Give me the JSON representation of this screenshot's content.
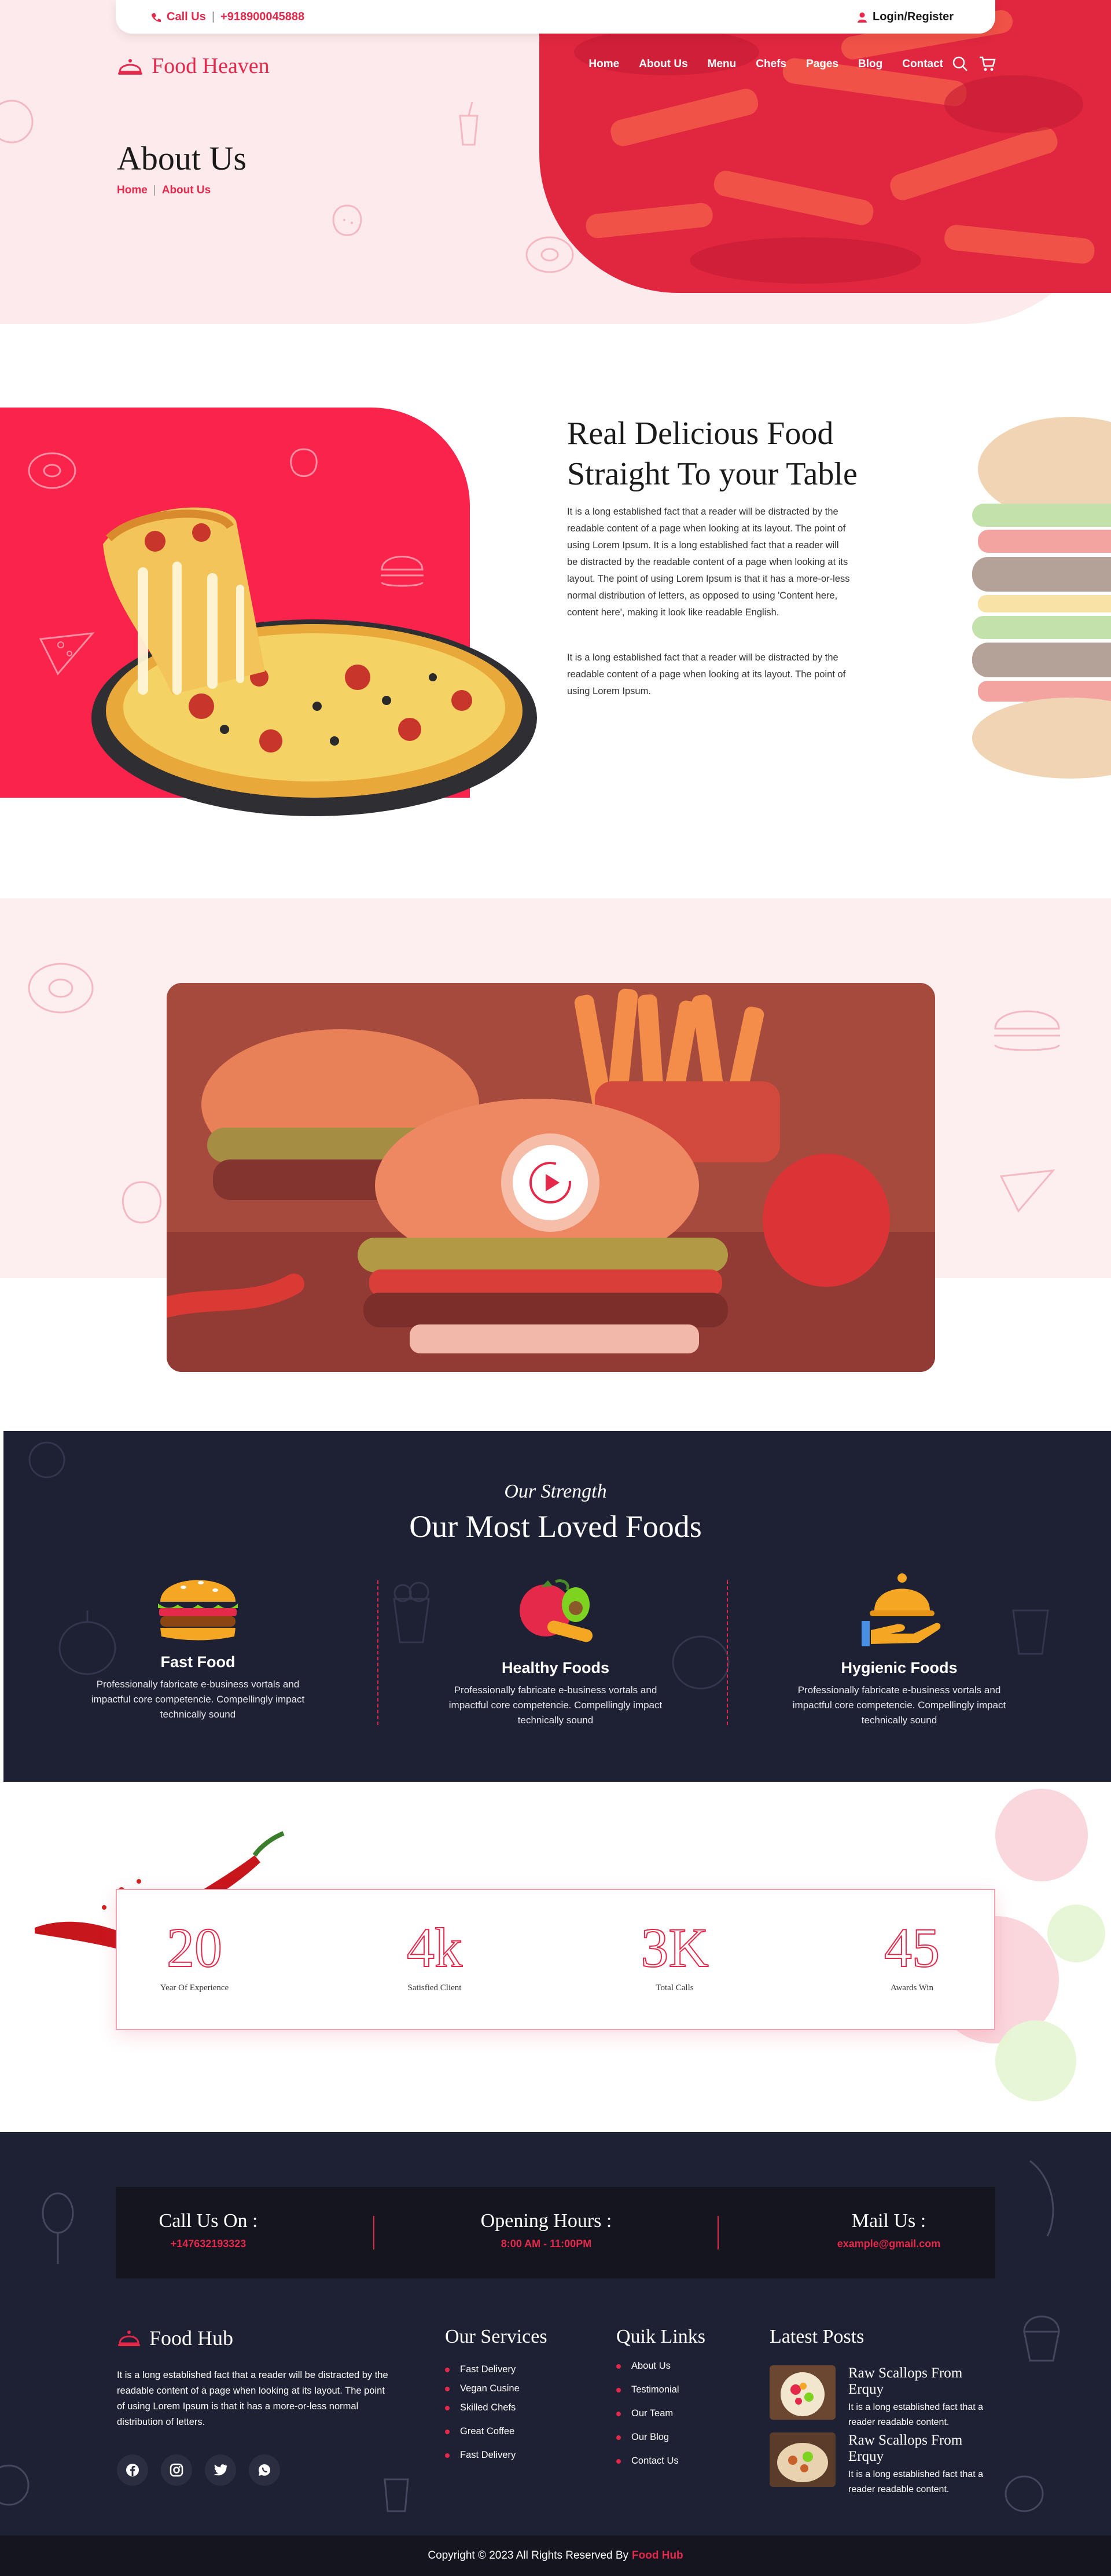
{
  "colors": {
    "accent": "#e5294b",
    "dark": "#1e2033",
    "darker": "#14151f",
    "blush": "#fdeaec"
  },
  "topbar": {
    "call_label": "Call Us",
    "phone": "+918900045888",
    "login": "Login/Register"
  },
  "header": {
    "logo": "Food Heaven",
    "nav": [
      "Home",
      "About Us",
      "Menu",
      "Chefs",
      "Pages",
      "Blog",
      "Contact"
    ]
  },
  "hero": {
    "title": "About Us",
    "breadcrumb": {
      "home": "Home",
      "current": "About Us"
    }
  },
  "intro": {
    "title_line1": "Real Delicious Food",
    "title_line2": "Straight To your Table",
    "para1": "It is a long established fact that a reader will be distracted by the readable content of a page when looking at its layout. The point of using Lorem Ipsum. It is a long established fact that a reader will be distracted by the readable content of a page when looking at its layout. The point of using Lorem Ipsum is that it has a more-or-less normal distribution of letters, as opposed to using 'Content here, content here', making it look like readable English.",
    "para2": "It is a long established fact that a reader will be distracted by the readable content of a page when looking at its layout. The point of using Lorem Ipsum."
  },
  "strength": {
    "kicker": "Our Strength",
    "title": "Our Most Loved Foods",
    "items": [
      {
        "title": "Fast Food",
        "text": "Professionally fabricate e-business vortals and impactful core competencie. Compellingly impact technically sound",
        "icon": "burger-icon"
      },
      {
        "title": "Healthy Foods",
        "text": "Professionally fabricate e-business vortals and impactful core competencie. Compellingly impact technically sound",
        "icon": "vegetables-icon"
      },
      {
        "title": "Hygienic Foods",
        "text": "Professionally fabricate e-business vortals and impactful core competencie. Compellingly impact technically sound",
        "icon": "cloche-icon"
      }
    ]
  },
  "stats": [
    {
      "value": "20",
      "label": "Year Of Experience"
    },
    {
      "value": "4k",
      "label": "Satisfied Client"
    },
    {
      "value": "3K",
      "label": "Total Calls"
    },
    {
      "value": "45",
      "label": "Awards Win"
    }
  ],
  "footer": {
    "contact": [
      {
        "title": "Call Us On :",
        "value": "+147632193323"
      },
      {
        "title": "Opening Hours :",
        "value": "8:00 AM - 11:00PM"
      },
      {
        "title": "Mail Us :",
        "value": "example@gmail.com"
      }
    ],
    "logo": "Food Hub",
    "about": "It is a long established fact that a reader will be distracted by the readable content of a page when looking at its layout. The point of using Lorem Ipsum is that it has a more-or-less normal distribution of letters.",
    "social": [
      "facebook-icon",
      "instagram-icon",
      "twitter-icon",
      "whatsapp-icon"
    ],
    "services_title": "Our Services",
    "services": [
      "Fast Delivery",
      "Vegan Cusine",
      "Skilled Chefs",
      "Great Coffee",
      "Fast Delivery"
    ],
    "links_title": "Quik Links",
    "links": [
      "About Us",
      "Testimonial",
      "Our Team",
      "Our Blog",
      "Contact Us"
    ],
    "posts_title": "Latest Posts",
    "posts": [
      {
        "title": "Raw Scallops From Erquy",
        "text": "It is a long established fact that a reader readable content."
      },
      {
        "title": "Raw Scallops From Erquy",
        "text": "It is a long established fact that a reader readable content."
      }
    ],
    "copyright": "Copyright © 2023 All Rights Reserved By",
    "brand": "Food Hub"
  }
}
